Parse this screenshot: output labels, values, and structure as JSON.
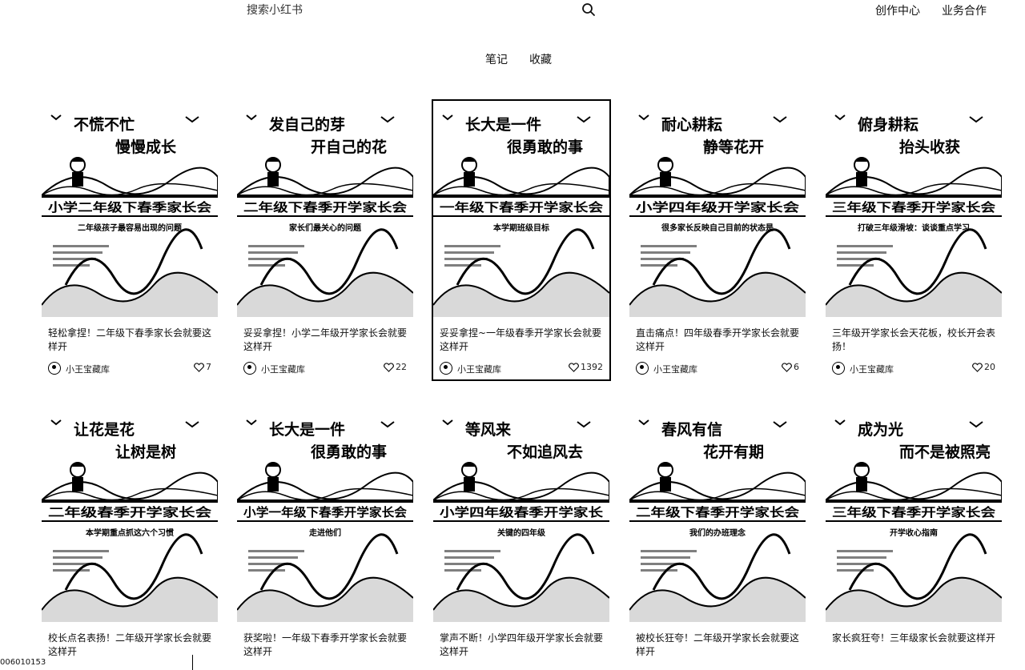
{
  "header": {
    "search_placeholder": "搜索小红书",
    "creator_center": "创作中心",
    "business": "业务合作"
  },
  "tabs": {
    "notes": "笔记",
    "favorites": "收藏"
  },
  "cards": [
    {
      "cover_line1": "不慌不忙",
      "cover_line2": "慢慢成长",
      "cover_main": "小学二年级下春季家长会",
      "cover_sub": "二年级孩子最容易出现的问题",
      "title": "轻松拿捏！二年级下春季家长会就要这样开",
      "author": "小王宝藏库",
      "likes": "7"
    },
    {
      "cover_line1": "发自己的芽",
      "cover_line2": "开自己的花",
      "cover_main": "二年级下春季开学家长会",
      "cover_sub": "家长们最关心的问题",
      "title": "妥妥拿捏！小学二年级开学家长会就要这样开",
      "author": "小王宝藏库",
      "likes": "22"
    },
    {
      "cover_line1": "长大是一件",
      "cover_line2": "很勇敢的事",
      "cover_main": "一年级下春季开学家长会",
      "cover_sub": "本学期班级目标",
      "title": "妥妥拿捏~一年级春季开学家长会就要这样开",
      "author": "小王宝藏库",
      "likes": "1392"
    },
    {
      "cover_line1": "耐心耕耘",
      "cover_line2": "静等花开",
      "cover_main": "小学四年级开学家长会",
      "cover_sub": "很多家长反映自己目前的状态是",
      "title": "直击痛点！四年级春季开学家长会就要这样开",
      "author": "小王宝藏库",
      "likes": "6"
    },
    {
      "cover_line1": "俯身耕耘",
      "cover_line2": "抬头收获",
      "cover_main": "三年级下春季开学家长会",
      "cover_sub": "打破三年级滑坡：谈谈重点学习",
      "title": "三年级开学家长会天花板，校长开会表扬！",
      "author": "小王宝藏库",
      "likes": "20"
    },
    {
      "cover_line1": "让花是花",
      "cover_line2": "让树是树",
      "cover_main": "二年级春季开学家长会",
      "cover_sub": "本学期重点抓这六个习惯",
      "title": "校长点名表扬！二年级开学家长会就要这样开",
      "author": "",
      "likes": ""
    },
    {
      "cover_line1": "长大是一件",
      "cover_line2": "很勇敢的事",
      "cover_main": "小学一年级下春季开学家长会",
      "cover_sub": "走进他们",
      "title": "获奖啦！一年级下春季开学家长会就要这样开",
      "author": "",
      "likes": ""
    },
    {
      "cover_line1": "等风来",
      "cover_line2": "不如追风去",
      "cover_main": "小学四年级春季开学家长",
      "cover_sub": "关键的四年级",
      "title": "掌声不断！小学四年级开学家长会就要这样开",
      "author": "",
      "likes": ""
    },
    {
      "cover_line1": "春风有信",
      "cover_line2": "花开有期",
      "cover_main": "二年级下春季开学家长会",
      "cover_sub": "我们的办班理念",
      "title": "被校长狂夸！二年级开学家长会就要这样开",
      "author": "",
      "likes": ""
    },
    {
      "cover_line1": "成为光",
      "cover_line2": "而不是被照亮",
      "cover_main": "三年级下春季开学家长会",
      "cover_sub": "开学收心指南",
      "title": "家长疯狂夸！三年级家长会就要这样开",
      "author": "",
      "likes": ""
    }
  ],
  "corner": {
    "id": "006010153"
  },
  "colors": {
    "ink": "#000000",
    "background": "#ffffff"
  }
}
